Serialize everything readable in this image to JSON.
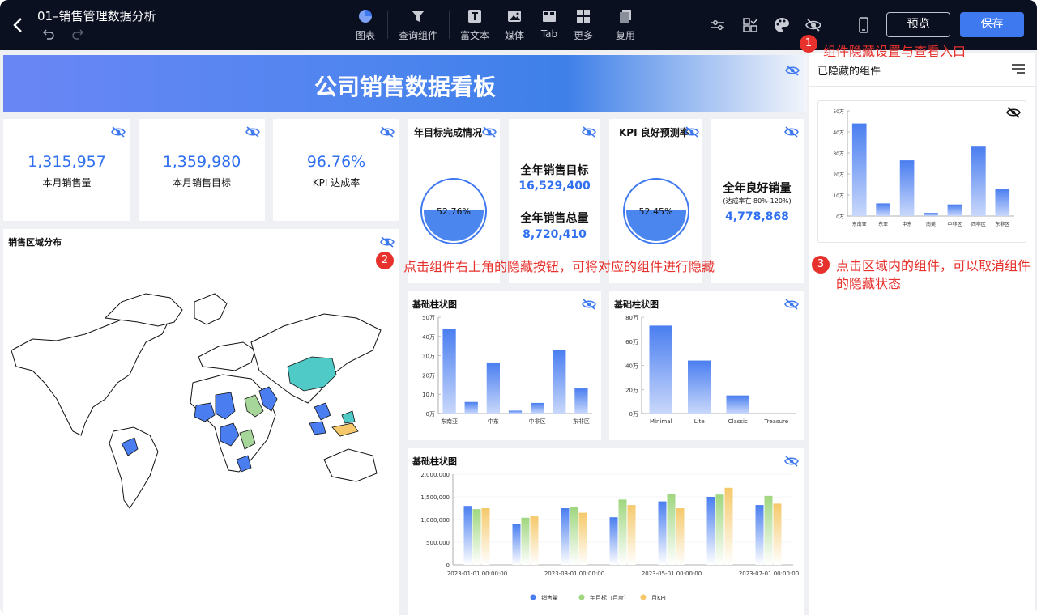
{
  "header": {
    "title": "01–销售管理数据分析",
    "tools": [
      {
        "label": "图表",
        "icon": "pie-chart-icon"
      },
      {
        "label": "查询组件",
        "icon": "filter-icon"
      },
      {
        "label": "富文本",
        "icon": "text-icon"
      },
      {
        "label": "媒体",
        "icon": "image-icon"
      },
      {
        "label": "Tab",
        "icon": "tab-icon"
      },
      {
        "label": "更多",
        "icon": "grid-icon"
      },
      {
        "label": "复用",
        "icon": "copy-icon"
      }
    ],
    "preview_label": "预览",
    "save_label": "保存"
  },
  "dashboard": {
    "title": "公司销售数据看板",
    "kpis": [
      {
        "value": "1,315,957",
        "label": "本月销售量"
      },
      {
        "value": "1,359,980",
        "label": "本月销售目标"
      },
      {
        "value": "96.76%",
        "label": "KPI 达成率"
      }
    ],
    "gauge1": {
      "title": "年目标完成情况",
      "value": "52.76%",
      "fill": 0.5276
    },
    "target": {
      "label1": "全年销售目标",
      "value1": "16,529,400",
      "label2": "全年销售总量",
      "value2": "8,720,410"
    },
    "gauge2": {
      "title": "KPI 良好预测率",
      "value": "52.45%",
      "fill": 0.5245
    },
    "good": {
      "label": "全年良好销量",
      "sub": "(达成率在 80%-120%)",
      "value": "4,778,868"
    },
    "map": {
      "title": "销售区域分布"
    }
  },
  "annotations": [
    {
      "num": "1",
      "text": "组件隐藏设置与查看入口"
    },
    {
      "num": "2",
      "text": "点击组件右上角的隐藏按钮，可将对应的组件进行隐藏"
    },
    {
      "num": "3",
      "text": "点击区域内的组件，可以取消组件的隐藏状态"
    }
  ],
  "right_panel": {
    "title": "已隐藏的组件"
  },
  "colors": {
    "accent": "#3f79f0",
    "annotation": "#e6312c",
    "series": [
      "#4a7ef0",
      "#9fd67e",
      "#f5c96b"
    ]
  },
  "chart_data": [
    {
      "id": "bar1",
      "type": "bar",
      "title": "基础柱状图",
      "categories": [
        "东南亚",
        "东亚",
        "中东",
        "南美",
        "中非区",
        "西非区",
        "东非区"
      ],
      "values": [
        44,
        6,
        26.5,
        1.5,
        5.5,
        33,
        13
      ],
      "ylim": [
        0,
        50
      ],
      "ticks": [
        "0万",
        "10万",
        "20万",
        "30万",
        "40万",
        "50万"
      ],
      "xticks_shown": [
        "东南亚",
        "中东",
        "中非区",
        "东非区"
      ]
    },
    {
      "id": "bar2",
      "type": "bar",
      "title": "基础柱状图",
      "categories": [
        "Minimal",
        "Lite",
        "Classic",
        "Treasure"
      ],
      "values": [
        73,
        44,
        15,
        0
      ],
      "ylim": [
        0,
        80
      ],
      "ticks": [
        "0万",
        "20万",
        "40万",
        "60万",
        "80万"
      ]
    },
    {
      "id": "bar3",
      "type": "bar",
      "title": "基础柱状图",
      "categories": [
        "2023-01",
        "2023-02",
        "2023-03",
        "2023-04",
        "2023-05",
        "2023-06",
        "2023-07"
      ],
      "xticks_shown": [
        "2023-01-01 00:00:00",
        "2023-03-01 00:00:00",
        "2023-05-01 00:00:00",
        "2023-07-01 00:00:00"
      ],
      "ylim": [
        0,
        2000000
      ],
      "ticks": [
        "0",
        "500,000",
        "1,000,000",
        "1,500,000",
        "2,000,000"
      ],
      "series": [
        {
          "name": "销售量",
          "values": [
            1300000,
            900000,
            1250000,
            1050000,
            1400000,
            1500000,
            1320000
          ]
        },
        {
          "name": "年目标（月度）",
          "values": [
            1230000,
            1040000,
            1270000,
            1440000,
            1570000,
            1550000,
            1520000
          ]
        },
        {
          "name": "月KPI",
          "values": [
            1250000,
            1070000,
            1150000,
            1320000,
            1250000,
            1700000,
            1350000
          ]
        }
      ]
    },
    {
      "id": "hidden",
      "type": "bar",
      "categories": [
        "东南亚",
        "东亚",
        "中东",
        "南美",
        "中非区",
        "西非区",
        "东非区"
      ],
      "values": [
        44,
        6,
        26.5,
        1.5,
        5.5,
        33,
        13
      ],
      "ylim": [
        0,
        50
      ],
      "ticks": [
        "0万",
        "10万",
        "20万",
        "30万",
        "40万",
        "50万"
      ]
    }
  ]
}
